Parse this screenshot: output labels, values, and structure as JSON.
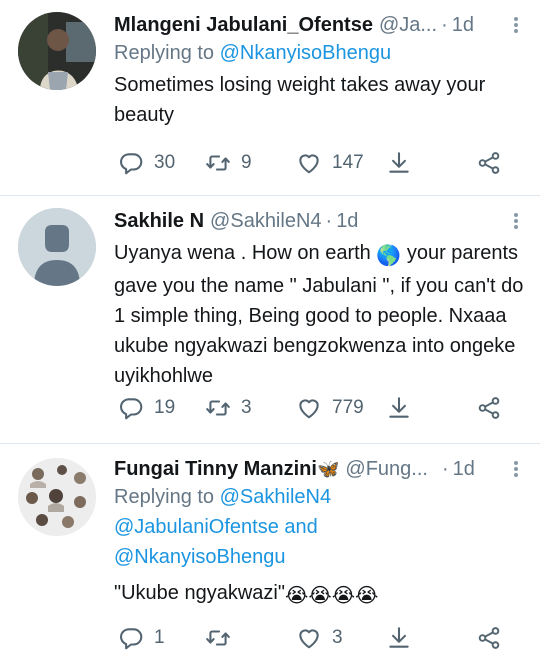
{
  "tweets": [
    {
      "name": "Mlangeni Jabulani_Ofentse",
      "handle": "@Ja...",
      "sep": "·",
      "time": "1d",
      "reply_prefix": "Replying to",
      "reply_to": "@NkanyisoBhengu",
      "text": "Sometimes losing weight takes away your beauty",
      "replies": "30",
      "retweets": "9",
      "likes": "147"
    },
    {
      "name": "Sakhile N",
      "handle": "@SakhileN4",
      "sep": "·",
      "time": "1d",
      "text_before_emoji": "Uyanya wena . How on earth",
      "emoji": "🌎",
      "text_after_emoji": "your parents gave you the name \" Jabulani \", if you can't do 1 simple thing, Being good to people. Nxaaa ukube ngyakwazi bengzokwenza into ongeke uyikhohlwe",
      "replies": "19",
      "retweets": "3",
      "likes": "779"
    },
    {
      "name": "Fungai Tinny Manzini",
      "name_emoji": "🦋",
      "handle": "@Fung...",
      "sep": "·",
      "time": "1d",
      "reply_prefix": "Replying to",
      "reply_to_1": "@SakhileN4",
      "reply_to_2": "@JabulaniOfentse",
      "reply_and": "and",
      "reply_to_3": "@NkanyisoBhengu",
      "text": "\"Ukube ngyakwazi\"",
      "emoji_tail": "😭😭😭😭",
      "replies": "1",
      "retweets": "",
      "likes": "3"
    }
  ],
  "icons": {
    "reply": "reply-icon",
    "retweet": "retweet-icon",
    "like": "heart-icon",
    "download": "download-arrow-icon",
    "share": "share-icon",
    "more": "more-dots-icon"
  },
  "colors": {
    "link": "#1b95e0",
    "secondary": "#657786",
    "icon": "#536471",
    "divider": "#e1e8ed"
  }
}
